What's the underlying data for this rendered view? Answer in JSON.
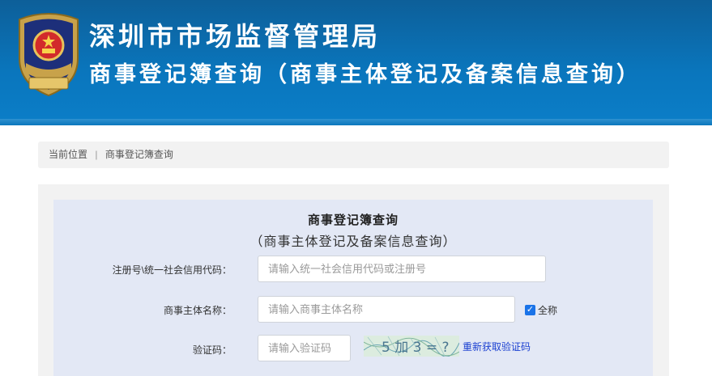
{
  "header": {
    "title": "深圳市市场监督管理局",
    "subtitle": "商事登记簿查询（商事主体登记及备案信息查询）",
    "emblem_text": "市场监督管理"
  },
  "breadcrumb": {
    "prefix": "当前位置",
    "separator": "|",
    "current": "商事登记簿查询"
  },
  "form": {
    "title": "商事登记簿查询",
    "subtitle": "（商事主体登记及备案信息查询）",
    "fields": {
      "reg_code": {
        "label": "注册号\\统一社会信用代码：",
        "placeholder": "请输入统一社会信用代码或注册号",
        "value": ""
      },
      "name": {
        "label": "商事主体名称：",
        "placeholder": "请输入商事主体名称",
        "value": ""
      },
      "captcha": {
        "label": "验证码：",
        "placeholder": "请输入验证码",
        "value": ""
      }
    },
    "fullname_checkbox": {
      "label": "全称",
      "checked": true
    },
    "captcha_image_text": "5 加 3 = ?",
    "refresh_link": "重新获取验证码"
  },
  "colors": {
    "banner": "#0a76bd",
    "panel_bg": "#e3e8f5",
    "checkbox": "#1a73e8",
    "link": "#1a3fd1"
  }
}
